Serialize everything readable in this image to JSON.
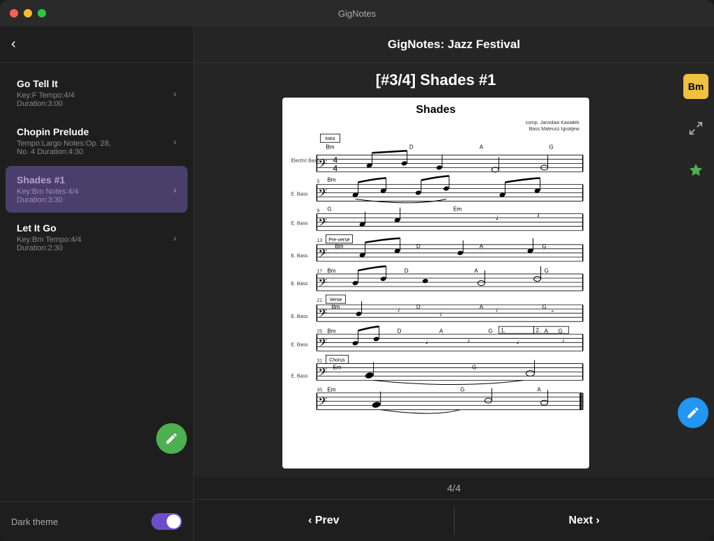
{
  "titlebar": {
    "title": "GigNotes"
  },
  "header": {
    "title": "GigNotes: Jazz Festival",
    "back_label": "‹"
  },
  "song_page": {
    "title": "[#3/4] Shades #1"
  },
  "sidebar": {
    "songs": [
      {
        "id": "go-tell-it",
        "name": "Go Tell It",
        "meta_line1": "Key:F  Tempo:4/4",
        "meta_line2": "Duration:3:00",
        "active": false
      },
      {
        "id": "chopin-prelude",
        "name": "Chopin Prelude",
        "meta_line1": "Tempo:Largo  Notes:Op. 28,",
        "meta_line2": "No. 4  Duration:4:30",
        "active": false
      },
      {
        "id": "shades",
        "name": "Shades #1",
        "meta_line1": "Key:Bm  Notes:4/4",
        "meta_line2": "Duration:3:30",
        "active": true
      },
      {
        "id": "let-it-go",
        "name": "Let It Go",
        "meta_line1": "Key:Bm  Tempo:4/4",
        "meta_line2": "Duration:2:30",
        "active": false
      }
    ],
    "dark_theme_label": "Dark theme"
  },
  "sheet": {
    "title": "Shades",
    "credits_line1": "comp. Jarosław Kawałek",
    "credits_line2": "Bass Mateusz Ignatjew"
  },
  "page_indicator": "4/4",
  "key_badge": "Bm",
  "nav": {
    "prev_label": "‹ Prev",
    "next_label": "Next ›"
  },
  "icons": {
    "back": "‹",
    "chevron": "›",
    "edit": "✎",
    "fullscreen": "⛶",
    "settings": "✳"
  }
}
